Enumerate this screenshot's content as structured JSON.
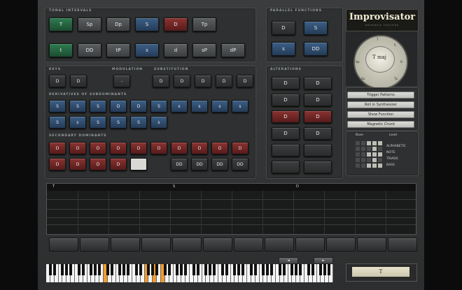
{
  "app": {
    "title": "Improvisator",
    "subtitle": "harmonic function"
  },
  "sections": {
    "tonal": "TONAL INTERVALS",
    "parallel": "PARALLEL FUNCTIONS",
    "keys": "KEYS",
    "modulation": "MODULATION",
    "substitution": "SUBSTITUTION",
    "secondary": "DERIVATIVES OF SUBDOMINANTS",
    "chromatic": "SECONDARY DOMINANTS",
    "alterations": "ALTERATIONS"
  },
  "row1": [
    {
      "label": "T",
      "color": "green"
    },
    {
      "label": "Sp",
      "color": "gray"
    },
    {
      "label": "Dp",
      "color": "gray"
    },
    {
      "label": "S",
      "color": "blue"
    },
    {
      "label": "D",
      "color": "red"
    },
    {
      "label": "Tp",
      "color": "gray"
    }
  ],
  "row2": [
    {
      "label": "t",
      "color": "green"
    },
    {
      "label": "DD",
      "color": "gray"
    },
    {
      "label": "tP",
      "color": "gray"
    },
    {
      "label": "s",
      "color": "blue"
    },
    {
      "label": "d",
      "color": "gray"
    },
    {
      "label": "sP",
      "color": "gray"
    },
    {
      "label": "dP",
      "color": "gray"
    }
  ],
  "parallel_buttons": [
    "D",
    "S",
    "s",
    "DD"
  ],
  "keys_buttons": [
    "D",
    "D"
  ],
  "modulation_buttons": [
    "-"
  ],
  "substitution_buttons": [
    "D",
    "D",
    "D",
    "D",
    "D"
  ],
  "secondary_rows": [
    [
      "S",
      "S",
      "S",
      "D",
      "D",
      "S",
      "s",
      "s",
      "s",
      "s"
    ],
    [
      "S",
      "s",
      "S",
      "S",
      "S",
      "s"
    ]
  ],
  "chromatic_rows": [
    [
      "D",
      "D",
      "D",
      "D",
      "D",
      "D",
      "D",
      "D",
      "D",
      "D"
    ],
    [
      "D",
      "D",
      "D",
      "D",
      "",
      "DD",
      "DD",
      "DD",
      "DD"
    ]
  ],
  "alteration_buttons": [
    "D",
    "D",
    "D",
    "D",
    "D",
    "D",
    "D",
    "D",
    "",
    "",
    "",
    ""
  ],
  "dial": {
    "label": "T maj",
    "ticks": [
      "T",
      "S",
      "D",
      "Tp",
      "Sp",
      "Dp"
    ]
  },
  "menu": [
    "Trigger Patterns",
    "Roll in Synthesizer",
    "Show Function",
    "Magnetic Chord"
  ],
  "options": {
    "left": "Base",
    "right": "Lead",
    "modes": [
      "ALPHABETIC",
      "NOTE",
      "TRIADS",
      "BASS"
    ]
  },
  "sequencer": {
    "markers": [
      "T",
      "S",
      "D"
    ]
  },
  "transport": [
    "◄",
    "►"
  ],
  "display": {
    "value": "T"
  },
  "keyboard": {
    "highlighted_white_keys": [
      14,
      24,
      26,
      28
    ]
  }
}
